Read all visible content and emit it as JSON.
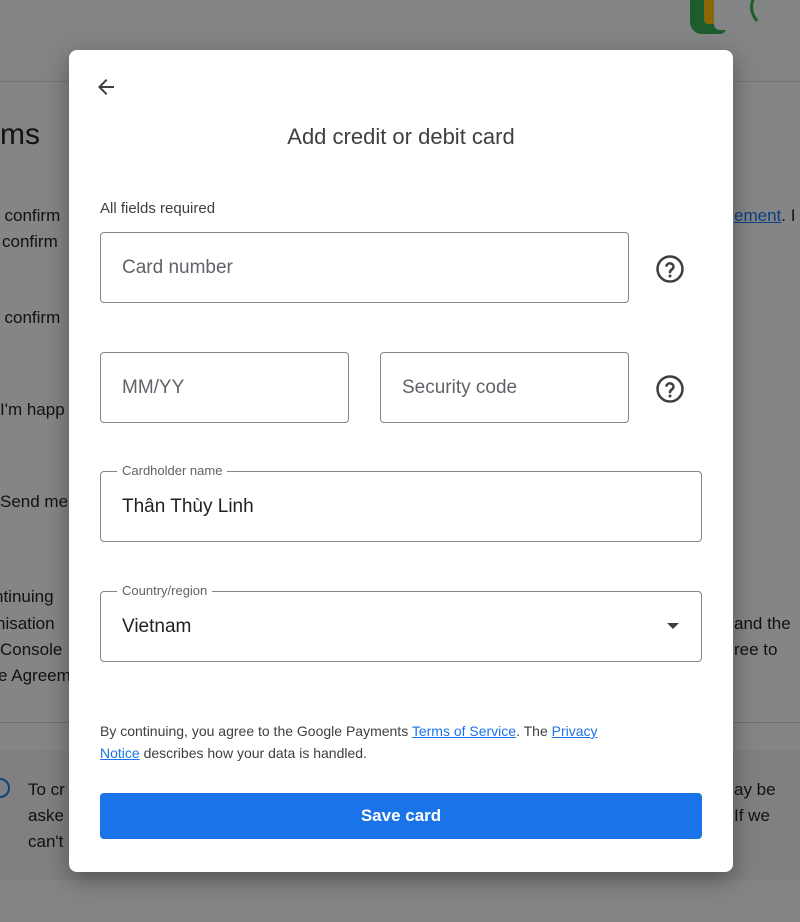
{
  "background": {
    "heading": "ms",
    "lines": [
      {
        "text": "l confirm"
      },
      {
        "text": "confirm"
      },
      {
        "text": "l confirm"
      },
      {
        "text": "I'm happ"
      },
      {
        "text": "Send me"
      },
      {
        "text": "ntinuing"
      },
      {
        "text": "nisation"
      },
      {
        "text": "Console"
      },
      {
        "text": "e Agreem"
      }
    ],
    "right_link": "ement",
    "right_link_suffix": ". I",
    "right_lines": [
      "and the",
      "ree to"
    ],
    "info_left": [
      "To cr",
      "aske",
      "can't"
    ],
    "info_right": [
      "ay be",
      "If we"
    ]
  },
  "dialog": {
    "title": "Add credit or debit card",
    "required_note": "All fields required",
    "card_number": {
      "placeholder": "Card number"
    },
    "expiry": {
      "placeholder": "MM/YY"
    },
    "security_code": {
      "placeholder": "Security code"
    },
    "cardholder": {
      "label": "Cardholder name",
      "value": "Thân Thùy Linh"
    },
    "country": {
      "label": "Country/region",
      "value": "Vietnam"
    },
    "legal": {
      "prefix": "By continuing, you agree to the Google Payments ",
      "terms_link": "Terms of Service",
      "middle": ". The ",
      "privacy_link_1": "Privacy",
      "privacy_link_2": "Notice",
      "suffix": " describes how your data is handled."
    },
    "save_label": "Save card"
  },
  "icons": {
    "back": "arrow-left-icon",
    "help": "help-circle-icon",
    "dropdown": "caret-down-icon"
  },
  "colors": {
    "accent": "#1a73e8",
    "outline": "#80868b",
    "text": "#202124"
  }
}
